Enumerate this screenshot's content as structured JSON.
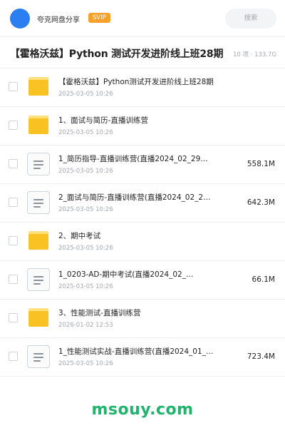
{
  "header": {
    "user_name": "夸克网盘分享",
    "badge": "SVIP",
    "search_placeholder": "搜索"
  },
  "folder": {
    "title": "【霍格沃兹】Python 测试开发进阶线上班28期",
    "meta": "10 项 · 133.7G"
  },
  "files": [
    {
      "type": "folder",
      "name": "【霍格沃兹】Python测试开发进阶线上班28期",
      "date": "2025-03-05 10:26",
      "size": ""
    },
    {
      "type": "folder",
      "name": "1、面试与简历-直播训练营",
      "date": "2025-03-05 10:26",
      "size": ""
    },
    {
      "type": "file",
      "name": "1_简历指导-直播训练营(直播2024_02_29…",
      "date": "2025-03-05 10:26",
      "size": "558.1M"
    },
    {
      "type": "file",
      "name": "2_面试与简历-直播训练营(直播2024_02_2…",
      "date": "2025-03-05 10:26",
      "size": "642.3M"
    },
    {
      "type": "folder",
      "name": "2、期中考试",
      "date": "2025-03-05 10:26",
      "size": ""
    },
    {
      "type": "file",
      "name": "1_0203-AD-期中考试(直播2024_02_…",
      "date": "2025-03-05 10:26",
      "size": "66.1M"
    },
    {
      "type": "folder",
      "name": "3、性能测试-直播训练营",
      "date": "2026-01-02 12:53",
      "size": ""
    },
    {
      "type": "file",
      "name": "1_性能测试实战-直播训练营(直播2024_01_…",
      "date": "2025-03-05 10:26",
      "size": "723.4M"
    }
  ],
  "watermark": "msouy.com",
  "colors": {
    "avatar": "#2b7ff0",
    "badge": "#f7a12b",
    "folder": "#f8c223",
    "watermark": "#1fb36b"
  }
}
